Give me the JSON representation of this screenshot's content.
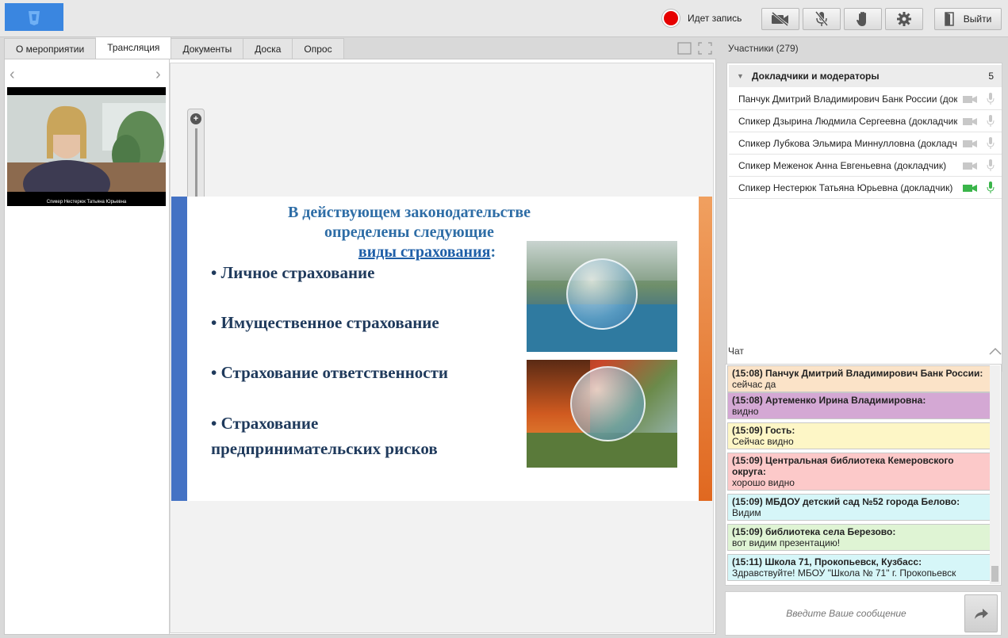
{
  "topbar": {
    "recording_text": "Идет запись",
    "exit_label": "Выйти"
  },
  "tabs": [
    {
      "label": "О мероприятии",
      "active": false
    },
    {
      "label": "Трансляция",
      "active": true
    },
    {
      "label": "Документы",
      "active": false
    },
    {
      "label": "Доска",
      "active": false
    },
    {
      "label": "Опрос",
      "active": false
    }
  ],
  "video": {
    "caption": "Спикер Нестерюк Татьяна Юрьевна"
  },
  "slide": {
    "title_line1": "В действующем законодательстве",
    "title_line2": "определены следующие",
    "title_line3": "виды страхования",
    "title_suffix": ":",
    "bullets": [
      "• Личное страхование",
      "• Имущественное страхование",
      "• Страхование ответственности",
      "• Страхование",
      "предпринимательских рисков"
    ]
  },
  "participants": {
    "header": "Участники (279)",
    "group_name": "Докладчики и модераторы",
    "group_count": "5",
    "items": [
      {
        "name": "Панчук Дмитрий Владимирович Банк России (докладчик)",
        "active": false
      },
      {
        "name": "Спикер Дзырина Людмила Сергеевна (докладчик)",
        "active": false
      },
      {
        "name": "Спикер Лубкова Эльмира Миннулловна (докладчик)",
        "active": false
      },
      {
        "name": "Спикер Меженок Анна Евгеньевна (докладчик)",
        "active": false
      },
      {
        "name": "Спикер Нестерюк Татьяна Юрьевна (докладчик)",
        "active": true
      }
    ]
  },
  "chat": {
    "label": "Чат",
    "messages": [
      {
        "head": "(15:08) Панчук Дмитрий Владимирович Банк России:",
        "text": "сейчас да",
        "color": "#fbe3c8"
      },
      {
        "head": "(15:08) Артеменко Ирина Владимировна:",
        "text": "видно",
        "color": "#d4a8d4"
      },
      {
        "head": "(15:09) Гость:",
        "text": "Сейчас видно",
        "color": "#fdf6c6"
      },
      {
        "head": "(15:09) Центральная библиотека Кемеровского округа:",
        "text": "хорошо видно",
        "color": "#fcc9c9"
      },
      {
        "head": "(15:09) МБДОУ детский сад №52 города Белово:",
        "text": "Видим",
        "color": "#d6f6f8"
      },
      {
        "head": "(15:09) библиотека села Березово:",
        "text": "вот видим презентацию!",
        "color": "#dff4d4"
      },
      {
        "head": "(15:11) Школа 71, Прокопьевск, Кузбасс:",
        "text": "Здравствуйте! МБОУ \"Школа № 71\" г. Прокопьевск",
        "color": "#d6f6f8"
      }
    ],
    "input_placeholder": "Введите Ваше сообщение"
  }
}
